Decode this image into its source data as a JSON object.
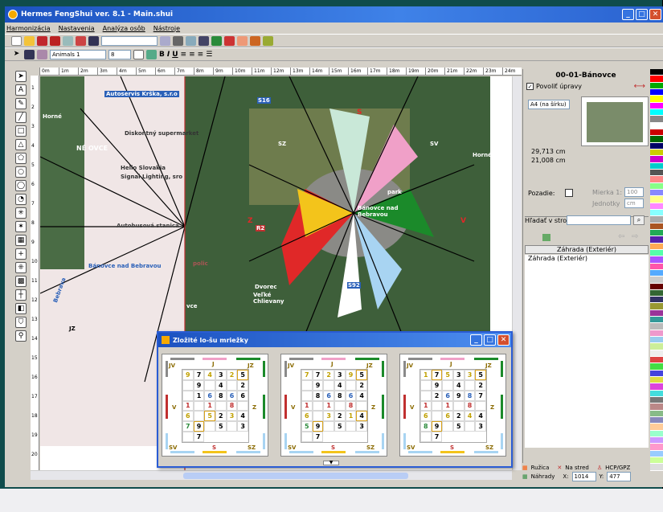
{
  "window": {
    "title": "Hermes FengShui ver. 8.1 - Main.shui"
  },
  "menu": [
    "Harmonizácia",
    "Nastavenia",
    "Analýza osôb",
    "Nástroje"
  ],
  "toolbar2": {
    "font": "Animals 1",
    "size": "8"
  },
  "ruler_top": [
    "0m",
    "1m",
    "2m",
    "3m",
    "4m",
    "5m",
    "6m",
    "7m",
    "8m",
    "9m",
    "10m",
    "11m",
    "12m",
    "13m",
    "14m",
    "15m",
    "16m",
    "17m",
    "18m",
    "19m",
    "20m",
    "21m",
    "22m",
    "23m",
    "24m"
  ],
  "ruler_left": [
    "1",
    "2",
    "3",
    "4",
    "5",
    "6",
    "7",
    "8",
    "9",
    "10",
    "11",
    "12",
    "13",
    "14",
    "15",
    "16",
    "17",
    "18",
    "19",
    "20"
  ],
  "map_labels": {
    "autoservis": "Autoservis Krška, s.r.o",
    "diskont": "Diskontný supermarket",
    "hello": "Hello Slovakia",
    "signal": "Signal Lighting, sro",
    "autobus": "Autobusová stanica",
    "banovce_bebr": "Bánovce nad Bebravou",
    "banovce_center": "Bánovce nad Bebravou",
    "dvorec": "Dvorec",
    "velke": "Veľké Chlievany",
    "horne": "Horné",
    "horne2": "Horné",
    "nove": "NÉ OVCE",
    "park": "park",
    "polic": "polic",
    "vce": "vce",
    "s": "S",
    "sz": "SZ",
    "sv": "SV",
    "jz": "JZ",
    "z": "Z",
    "v": "V",
    "j": "J",
    "bebrava": "Bebrava",
    "r2": "R2",
    "s16": "S16",
    "s92": "S92"
  },
  "right_panel": {
    "title": "00-01-Bánovce",
    "checkbox_label": "Povoliť úpravy",
    "paper": "A4 (na šírku)",
    "width": "29,713 cm",
    "height": "21,008 cm",
    "pozadie": "Pozadie:",
    "mierka": "Mierka 1:",
    "mierka_val": "100",
    "jednotky": "Jednotky",
    "jednotky_val": "cm",
    "search_label": "Hľadať v strome:",
    "tree_header": "Záhrada (Exteriér)",
    "tree_item": "Záhrada (Exteriér)"
  },
  "status": {
    "ruzica": "Ružica",
    "na_stred": "Na stred",
    "hcp": "HCP/GPZ",
    "nahrady": "Náhrady",
    "x_label": "X:",
    "x_val": "1014",
    "y_label": "Y:",
    "y_val": "477"
  },
  "dialog": {
    "title": "Zložité lo-šu mriežky",
    "grids": [
      {
        "cells": [
          "9",
          "7",
          "4",
          "3",
          "2",
          "5",
          "",
          "9",
          "",
          "4",
          "",
          "2",
          "",
          "1",
          "6",
          "8",
          "6",
          "6",
          "1",
          "",
          "1",
          "",
          "8",
          "",
          "6",
          "",
          "5",
          "2",
          "3",
          "4",
          "7",
          "9",
          "",
          "5",
          "",
          "3",
          "",
          "7"
        ],
        "hl": [
          5,
          26,
          31
        ]
      },
      {
        "cells": [
          "7",
          "7",
          "2",
          "3",
          "9",
          "5",
          "",
          "9",
          "",
          "4",
          "",
          "2",
          "",
          "8",
          "6",
          "8",
          "6",
          "4",
          "1",
          "",
          "1",
          "",
          "8",
          "",
          "6",
          "",
          "3",
          "2",
          "1",
          "4",
          "5",
          "9",
          "",
          "5",
          "",
          "3",
          "",
          "7"
        ],
        "hl": [
          5,
          29,
          31
        ]
      },
      {
        "cells": [
          "1",
          "7",
          "5",
          "3",
          "3",
          "5",
          "",
          "9",
          "",
          "4",
          "",
          "2",
          "",
          "2",
          "6",
          "9",
          "8",
          "7",
          "1",
          "",
          "1",
          "",
          "8",
          "",
          "6",
          "",
          "6",
          "2",
          "4",
          "4",
          "8",
          "9",
          "",
          "5",
          "",
          "3",
          "",
          "7"
        ],
        "hl": [
          1,
          5,
          31
        ]
      }
    ],
    "dirs": {
      "jv": "JV",
      "j": "J",
      "jz": "JZ",
      "v": "V",
      "z": "Z",
      "sv": "SV",
      "s": "S",
      "sz": "SZ"
    }
  }
}
